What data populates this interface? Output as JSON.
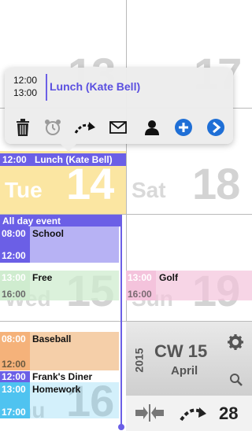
{
  "popup": {
    "start_time": "12:00",
    "end_time": "13:00",
    "title": "Lunch (Kate Bell)",
    "actions": [
      "delete",
      "alarm",
      "move",
      "mail",
      "contact",
      "add",
      "forward"
    ]
  },
  "days": {
    "top_left_number": "13",
    "top_right_number": "17",
    "tue": {
      "name": "Tue",
      "number": "14"
    },
    "sat": {
      "name": "Sat",
      "number": "18"
    },
    "wed": {
      "name": "Wed",
      "number": "15"
    },
    "sun": {
      "name": "Sun",
      "number": "19"
    },
    "thu": {
      "name": "Thu",
      "number": "16"
    }
  },
  "events": {
    "lunch": {
      "time": "12:00",
      "title": "Lunch (Kate Bell)"
    },
    "all_day": "All day event",
    "school": {
      "start": "08:00",
      "title": "School",
      "end": "12:00"
    },
    "free": {
      "start": "13:00",
      "title": "Free",
      "end": "16:00"
    },
    "golf": {
      "start": "13:00",
      "title": "Golf",
      "end": "16:00"
    },
    "baseball": {
      "start": "08:00",
      "title": "Baseball",
      "end": "12:00"
    },
    "franks": {
      "start": "12:00",
      "title": "Frank's Diner"
    },
    "homework": {
      "start": "13:00",
      "title": "Homework",
      "end": "17:00"
    }
  },
  "week_panel": {
    "year": "2015",
    "week": "CW 15",
    "month": "April"
  },
  "bottom_bar": {
    "day_number": "28"
  },
  "colors": {
    "accent": "#6b5fe6",
    "tue_bg": "#fbe6a2",
    "school": "#b7b2f4",
    "free": "#cfeccf",
    "golf": "#f4c3dc",
    "baseball": "#f5cfa9",
    "homework": "#4fc3f0"
  }
}
